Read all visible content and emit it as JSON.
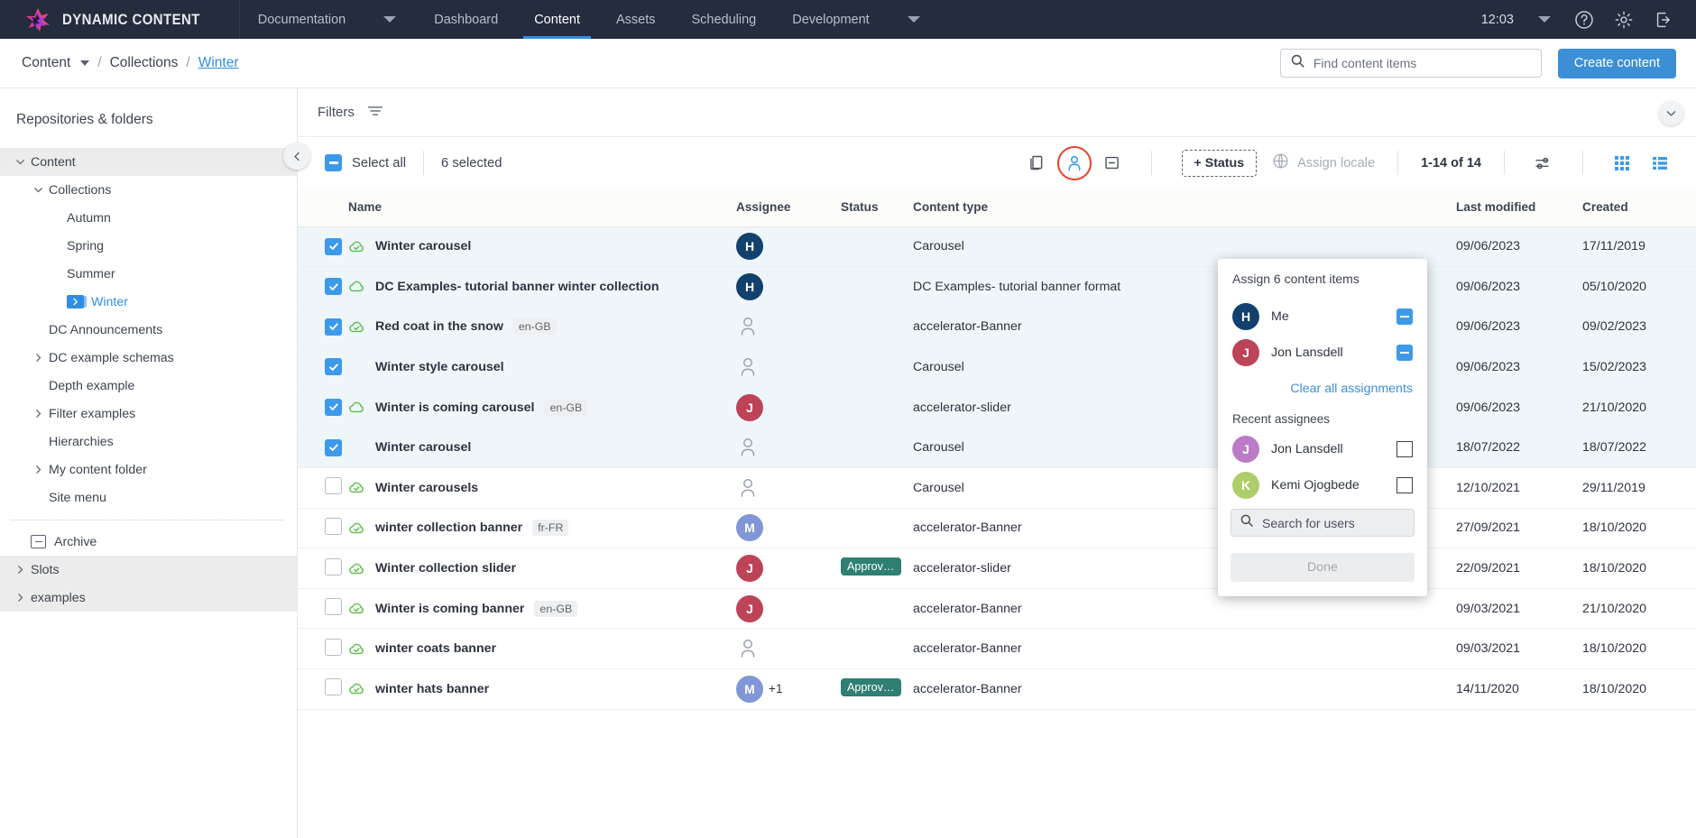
{
  "topnav": {
    "brand": "DYNAMIC CONTENT",
    "items": [
      {
        "label": "Documentation",
        "active": false,
        "caret": true
      },
      {
        "label": "Dashboard",
        "active": false,
        "caret": false
      },
      {
        "label": "Content",
        "active": true,
        "caret": false
      },
      {
        "label": "Assets",
        "active": false,
        "caret": false
      },
      {
        "label": "Scheduling",
        "active": false,
        "caret": false
      },
      {
        "label": "Development",
        "active": false,
        "caret": true
      }
    ],
    "clock": "12:03",
    "icons": [
      "chevron-down-icon",
      "help-icon",
      "gear-icon",
      "logout-icon"
    ]
  },
  "breadcrumb": {
    "root": "Content",
    "sep": "/",
    "middle": "Collections",
    "current": "Winter"
  },
  "search": {
    "placeholder": "Find content items",
    "value": ""
  },
  "create_button": {
    "label": "Create content"
  },
  "sidebar": {
    "title": "Repositories & folders",
    "items": [
      {
        "label": "Content",
        "indent": 0,
        "chev": "down",
        "shaded": true,
        "selected": false,
        "icon": "none"
      },
      {
        "label": "Collections",
        "indent": 1,
        "chev": "down",
        "shaded": false,
        "selected": false,
        "icon": "none"
      },
      {
        "label": "Autumn",
        "indent": 2,
        "chev": "none",
        "shaded": false,
        "selected": false,
        "icon": "none"
      },
      {
        "label": "Spring",
        "indent": 2,
        "chev": "none",
        "shaded": false,
        "selected": false,
        "icon": "none"
      },
      {
        "label": "Summer",
        "indent": 2,
        "chev": "none",
        "shaded": false,
        "selected": false,
        "icon": "none"
      },
      {
        "label": "Winter",
        "indent": 2,
        "chev": "none",
        "shaded": false,
        "selected": true,
        "icon": "folder"
      },
      {
        "label": "DC Announcements",
        "indent": 1,
        "chev": "none",
        "shaded": false,
        "selected": false,
        "icon": "none"
      },
      {
        "label": "DC example schemas",
        "indent": 1,
        "chev": "right",
        "shaded": false,
        "selected": false,
        "icon": "none"
      },
      {
        "label": "Depth example",
        "indent": 1,
        "chev": "none",
        "shaded": false,
        "selected": false,
        "icon": "none"
      },
      {
        "label": "Filter examples",
        "indent": 1,
        "chev": "right",
        "shaded": false,
        "selected": false,
        "icon": "none"
      },
      {
        "label": "Hierarchies",
        "indent": 1,
        "chev": "none",
        "shaded": false,
        "selected": false,
        "icon": "none"
      },
      {
        "label": "My content folder",
        "indent": 1,
        "chev": "right",
        "shaded": false,
        "selected": false,
        "icon": "none"
      },
      {
        "label": "Site menu",
        "indent": 1,
        "chev": "none",
        "shaded": false,
        "selected": false,
        "icon": "none"
      }
    ],
    "after_divider": [
      {
        "label": "Archive",
        "indent": 0,
        "chev": "none",
        "shaded": false,
        "selected": false,
        "icon": "archive"
      },
      {
        "label": "Slots",
        "indent": 0,
        "chev": "right",
        "shaded": true,
        "selected": false,
        "icon": "none"
      },
      {
        "label": "examples",
        "indent": 0,
        "chev": "right",
        "shaded": true,
        "selected": false,
        "icon": "none"
      }
    ]
  },
  "filters": {
    "label": "Filters",
    "icon": "filter-icon"
  },
  "actionbar": {
    "select_all": "Select all",
    "selected_count": "6 selected",
    "status_button": "+ Status",
    "assign_locale": "Assign locale",
    "pager": "1-14 of 14",
    "icons": [
      "copy-icon",
      "assign-user-icon",
      "unassign-icon",
      "globe-icon",
      "settings-sliders-icon",
      "grid-view-icon",
      "list-view-icon"
    ]
  },
  "assign_popover": {
    "title": "Assign 6 content items",
    "assigned": [
      {
        "initial": "H",
        "name": "Me",
        "color": "#12416e",
        "control": "minus"
      },
      {
        "initial": "J",
        "name": "Jon Lansdell",
        "color": "#bd4356",
        "control": "minus"
      }
    ],
    "clear_label": "Clear all assignments",
    "recent_label": "Recent assignees",
    "recent": [
      {
        "initial": "J",
        "name": "Jon Lansdell",
        "color": "#bb7bc6",
        "control": "checkbox"
      },
      {
        "initial": "K",
        "name": "Kemi Ojogbede",
        "color": "#adce69",
        "control": "checkbox"
      }
    ],
    "search_placeholder": "Search for users",
    "done_label": "Done"
  },
  "table": {
    "columns": [
      "",
      "Name",
      "Assignee",
      "Status",
      "Content type",
      "Last modified",
      "Created"
    ],
    "rows": [
      {
        "checked": true,
        "pub": "published",
        "name": "Winter carousel",
        "locale": "",
        "assignee": {
          "initial": "H",
          "color": "#12416e"
        },
        "extra": "",
        "status": "",
        "type": "Carousel",
        "modified": "09/06/2023",
        "created": "17/11/2019"
      },
      {
        "checked": true,
        "pub": "draft",
        "name": "DC Examples- tutorial banner winter collection",
        "locale": "",
        "assignee": {
          "initial": "H",
          "color": "#12416e"
        },
        "extra": "",
        "status": "",
        "type": "DC Examples- tutorial banner format",
        "modified": "09/06/2023",
        "created": "05/10/2020"
      },
      {
        "checked": true,
        "pub": "published",
        "name": "Red coat in the snow",
        "locale": "en-GB",
        "assignee": null,
        "extra": "",
        "status": "",
        "type": "accelerator-Banner",
        "modified": "09/06/2023",
        "created": "09/02/2023"
      },
      {
        "checked": true,
        "pub": "none",
        "name": "Winter style carousel",
        "locale": "",
        "assignee": null,
        "extra": "",
        "status": "",
        "type": "Carousel",
        "modified": "09/06/2023",
        "created": "15/02/2023"
      },
      {
        "checked": true,
        "pub": "draft",
        "name": "Winter is coming carousel",
        "locale": "en-GB",
        "assignee": {
          "initial": "J",
          "color": "#bd4356"
        },
        "extra": "",
        "status": "",
        "type": "accelerator-slider",
        "modified": "09/06/2023",
        "created": "21/10/2020"
      },
      {
        "checked": true,
        "pub": "none",
        "name": "Winter carousel",
        "locale": "",
        "assignee": null,
        "extra": "",
        "status": "",
        "type": "Carousel",
        "modified": "18/07/2022",
        "created": "18/07/2022"
      },
      {
        "checked": false,
        "pub": "published",
        "name": "Winter carousels",
        "locale": "",
        "assignee": null,
        "extra": "",
        "status": "",
        "type": "Carousel",
        "modified": "12/10/2021",
        "created": "29/11/2019"
      },
      {
        "checked": false,
        "pub": "published",
        "name": "winter collection banner",
        "locale": "fr-FR",
        "assignee": {
          "initial": "M",
          "color": "#8096d6"
        },
        "extra": "",
        "status": "",
        "type": "accelerator-Banner",
        "modified": "27/09/2021",
        "created": "18/10/2020"
      },
      {
        "checked": false,
        "pub": "published",
        "name": "Winter collection slider",
        "locale": "",
        "assignee": {
          "initial": "J",
          "color": "#bd4356"
        },
        "extra": "",
        "status": "Approv…",
        "type": "accelerator-slider",
        "modified": "22/09/2021",
        "created": "18/10/2020"
      },
      {
        "checked": false,
        "pub": "published",
        "name": "Winter is coming banner",
        "locale": "en-GB",
        "assignee": {
          "initial": "J",
          "color": "#bd4356"
        },
        "extra": "",
        "status": "",
        "type": "accelerator-Banner",
        "modified": "09/03/2021",
        "created": "21/10/2020"
      },
      {
        "checked": false,
        "pub": "published",
        "name": "winter coats banner",
        "locale": "",
        "assignee": null,
        "extra": "",
        "status": "",
        "type": "accelerator-Banner",
        "modified": "09/03/2021",
        "created": "18/10/2020"
      },
      {
        "checked": false,
        "pub": "published",
        "name": "winter hats banner",
        "locale": "",
        "assignee": {
          "initial": "M",
          "color": "#8096d6"
        },
        "extra": "+1",
        "status": "Approv…",
        "type": "accelerator-Banner",
        "modified": "14/11/2020",
        "created": "18/10/2020"
      }
    ]
  },
  "colors": {
    "nav_bg": "#242c3d",
    "accent": "#3d8fd5",
    "link": "#2f8de4",
    "selected_row": "#eef6fa",
    "badge_green": "#2f7f72",
    "highlight_ring": "#e8402a"
  }
}
